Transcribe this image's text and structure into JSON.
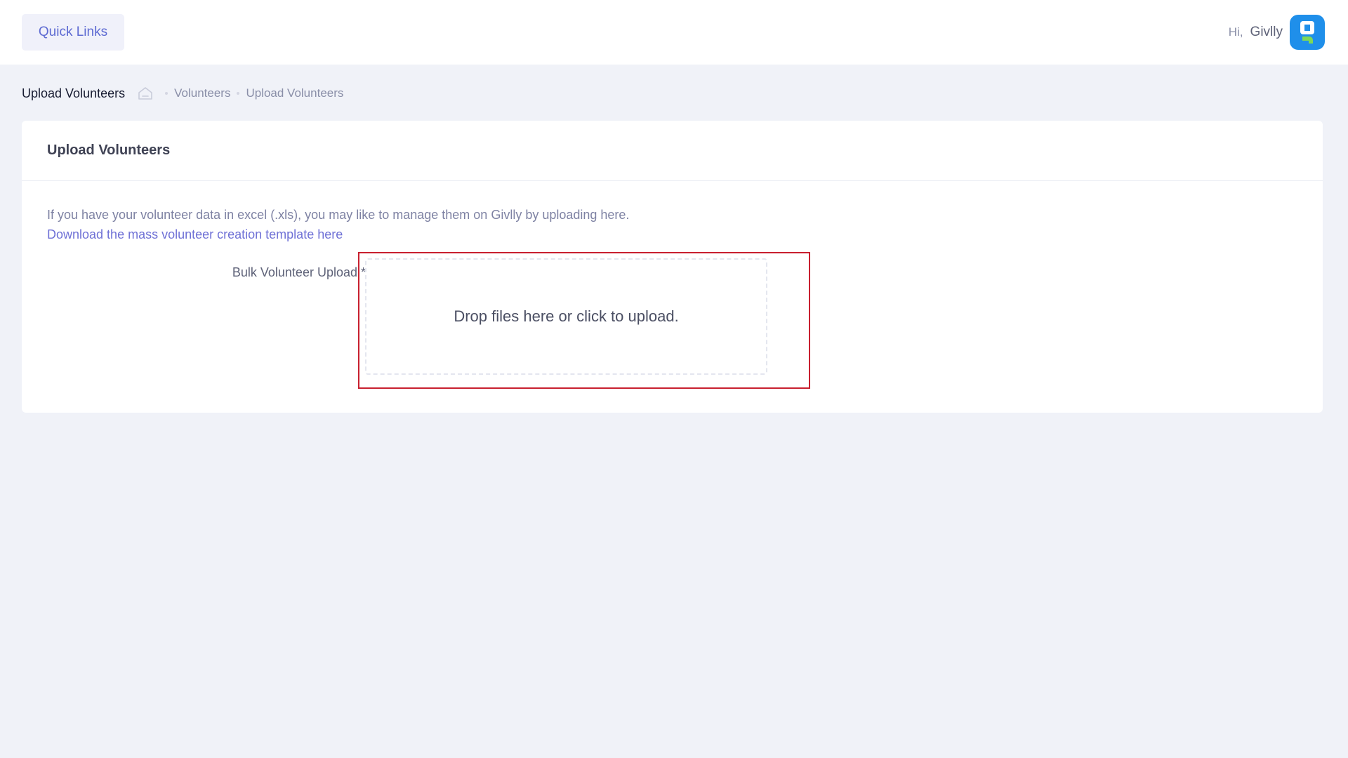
{
  "header": {
    "quick_links_label": "Quick Links",
    "greeting": "Hi,",
    "username": "Givlly",
    "avatar_icon": "givlly-logo-icon"
  },
  "subheader": {
    "page_title": "Upload Volunteers",
    "breadcrumbs": [
      {
        "label": "Volunteers"
      },
      {
        "label": "Upload Volunteers"
      }
    ]
  },
  "card": {
    "title": "Upload Volunteers",
    "info_text": "If you have your volunteer data in excel (.xls), you may like to manage them on Givlly by uploading here.",
    "template_link": "Download the mass volunteer creation template here",
    "field_label": "Bulk Volunteer Upload *",
    "dropzone_text": "Drop files here or click to upload."
  },
  "colors": {
    "accent": "#5d6ad2",
    "link": "#6f71d6",
    "highlight_border": "#c8202f",
    "avatar_bg": "#1f8fea",
    "page_bg": "#f0f2f8"
  }
}
